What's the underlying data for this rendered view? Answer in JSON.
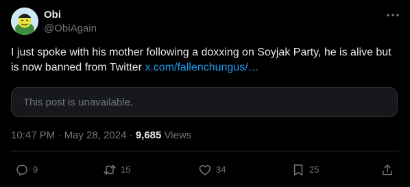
{
  "author": {
    "display_name": "Obi",
    "handle": "@ObiAgain"
  },
  "post": {
    "text": "I just spoke with his mother following a doxxing on Soyjak Party, he is alive but is now banned from Twitter ",
    "link": "x.com/fallenchungus/…",
    "quoted_card": "This post is unavailable."
  },
  "meta": {
    "time": "10:47 PM",
    "separator": "·",
    "date": "May 28, 2024",
    "views_count": "9,685",
    "views_label": "Views"
  },
  "actions": {
    "replies": "9",
    "reposts": "15",
    "likes": "34",
    "bookmarks": "25"
  },
  "icons": {
    "more": "more-icon",
    "reply": "reply-icon",
    "repost": "repost-icon",
    "like": "like-icon",
    "bookmark": "bookmark-icon",
    "share": "share-icon"
  },
  "colors": {
    "background": "#000000",
    "text": "#e7e9ea",
    "muted": "#71767b",
    "link": "#1d9bf0",
    "border": "#2f3336",
    "card_bg": "#16181c"
  }
}
